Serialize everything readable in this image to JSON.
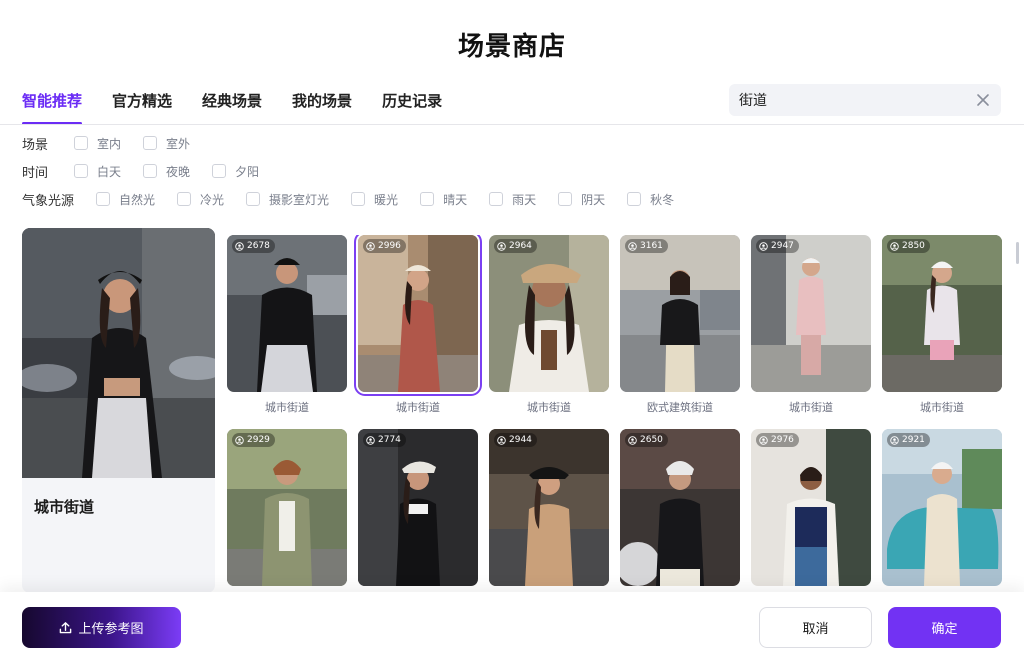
{
  "title": "场景商店",
  "tabs": [
    {
      "label": "智能推荐"
    },
    {
      "label": "官方精选"
    },
    {
      "label": "经典场景"
    },
    {
      "label": "我的场景"
    },
    {
      "label": "历史记录"
    }
  ],
  "search": {
    "value": "街道"
  },
  "filters": [
    {
      "label": "场景",
      "options": [
        "室内",
        "室外"
      ]
    },
    {
      "label": "时间",
      "options": [
        "白天",
        "夜晚",
        "夕阳"
      ]
    },
    {
      "label": "气象光源",
      "options": [
        "自然光",
        "冷光",
        "摄影室灯光",
        "暖光",
        "晴天",
        "雨天",
        "阴天",
        "秋冬"
      ]
    }
  ],
  "preview": {
    "name": "城市街道"
  },
  "cards": [
    {
      "count": "2678",
      "label": "城市街道"
    },
    {
      "count": "2996",
      "label": "城市街道",
      "selected": true
    },
    {
      "count": "2964",
      "label": "城市街道"
    },
    {
      "count": "3161",
      "label": "欧式建筑街道"
    },
    {
      "count": "2947",
      "label": "城市街道"
    },
    {
      "count": "2850",
      "label": "城市街道"
    },
    {
      "count": "2929",
      "label": ""
    },
    {
      "count": "2774",
      "label": ""
    },
    {
      "count": "2944",
      "label": ""
    },
    {
      "count": "2650",
      "label": ""
    },
    {
      "count": "2976",
      "label": ""
    },
    {
      "count": "2921",
      "label": ""
    }
  ],
  "footer": {
    "upload_label": "上传参考图",
    "cancel_label": "取消",
    "confirm_label": "确定"
  },
  "colors": {
    "accent": "#7232f3",
    "tab_active": "#6b2cf5"
  }
}
